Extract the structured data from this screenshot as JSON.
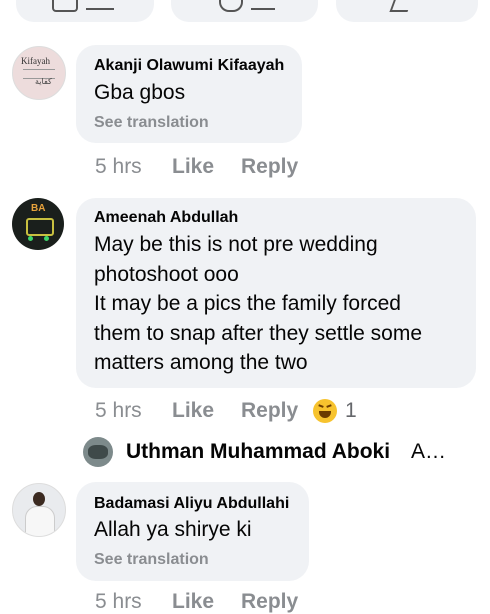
{
  "comments": [
    {
      "author": "Akanji Olawumi Kifaayah",
      "text": "Gba gbos",
      "see_translation": "See translation",
      "time": "5 hrs",
      "like": "Like",
      "reply": "Reply",
      "avatar_text": "Kifayah",
      "avatar_arabic": "كفاية"
    },
    {
      "author": "Ameenah Abdullah",
      "text_lines": [
        "May be this is not pre wedding",
        "photoshoot ooo",
        "It may be a pics the family forced",
        "them to snap after they settle some",
        "matters among the two"
      ],
      "time": "5 hrs",
      "like": "Like",
      "reply": "Reply",
      "reaction_count": "1",
      "avatar_text": "BA"
    },
    {
      "author": "Badamasi Aliyu Abdullahi",
      "text": "Allah ya shirye ki",
      "see_translation": "See translation",
      "time": "5 hrs",
      "like": "Like",
      "reply": "Reply"
    }
  ],
  "reply_preview": {
    "author": "Uthman Muhammad Aboki",
    "snippet": "A…"
  },
  "colors": {
    "bubble": "#f0f2f5",
    "meta": "#8a8d91",
    "text": "#050505"
  }
}
